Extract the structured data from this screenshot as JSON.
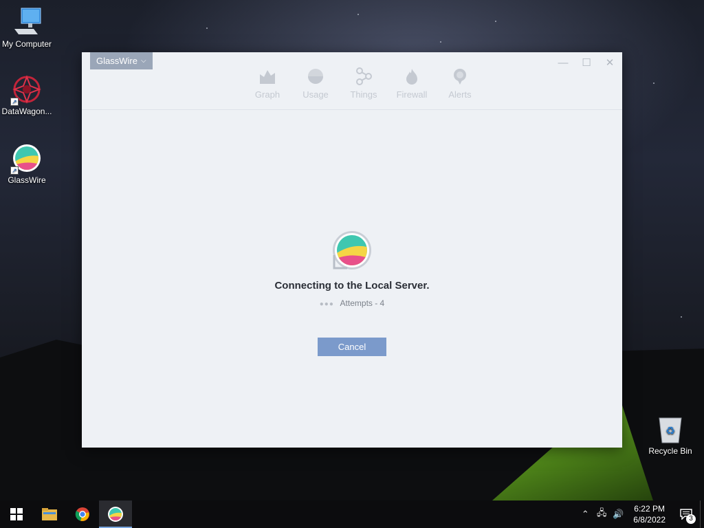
{
  "desktop": {
    "icons": [
      {
        "label": "My Computer"
      },
      {
        "label": "DataWagon..."
      },
      {
        "label": "GlassWire"
      },
      {
        "label": "Recycle Bin"
      }
    ]
  },
  "window": {
    "app_menu": "GlassWire",
    "nav": [
      {
        "label": "Graph",
        "icon": "graph-icon"
      },
      {
        "label": "Usage",
        "icon": "usage-icon"
      },
      {
        "label": "Things",
        "icon": "things-icon"
      },
      {
        "label": "Firewall",
        "icon": "firewall-icon"
      },
      {
        "label": "Alerts",
        "icon": "alerts-icon"
      }
    ],
    "status": {
      "heading": "Connecting to the Local Server.",
      "attempts": "Attempts - 4"
    },
    "cancel_label": "Cancel"
  },
  "taskbar": {
    "clock_time": "6:22 PM",
    "clock_date": "6/8/2022",
    "notification_count": "3"
  },
  "colors": {
    "accent_button": "#7b9acb",
    "app_menu_bg": "#9aa6b8",
    "window_bg": "#eef1f5"
  }
}
